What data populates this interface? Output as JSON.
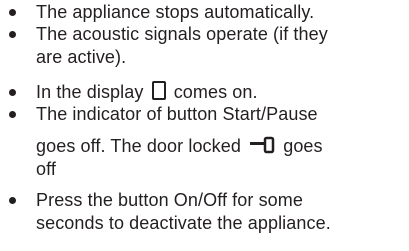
{
  "document": {
    "items": [
      {
        "lines": [
          "The appliance stops automatically."
        ]
      },
      {
        "lines": [
          "The acoustic signals operate (if they",
          "are active)."
        ]
      },
      {
        "before": "In the display",
        "display_icon": "display-segment-icon",
        "after": "comes on."
      },
      {
        "lines_top": [
          "The indicator of button Start/Pause"
        ],
        "line2_before": "goes off. The door locked",
        "door_icon": "door-locked-icon",
        "line2_after": "goes",
        "line3": "off"
      },
      {
        "lines": [
          "Press the button On/Off for some",
          "seconds to deactivate the appliance."
        ]
      }
    ]
  }
}
